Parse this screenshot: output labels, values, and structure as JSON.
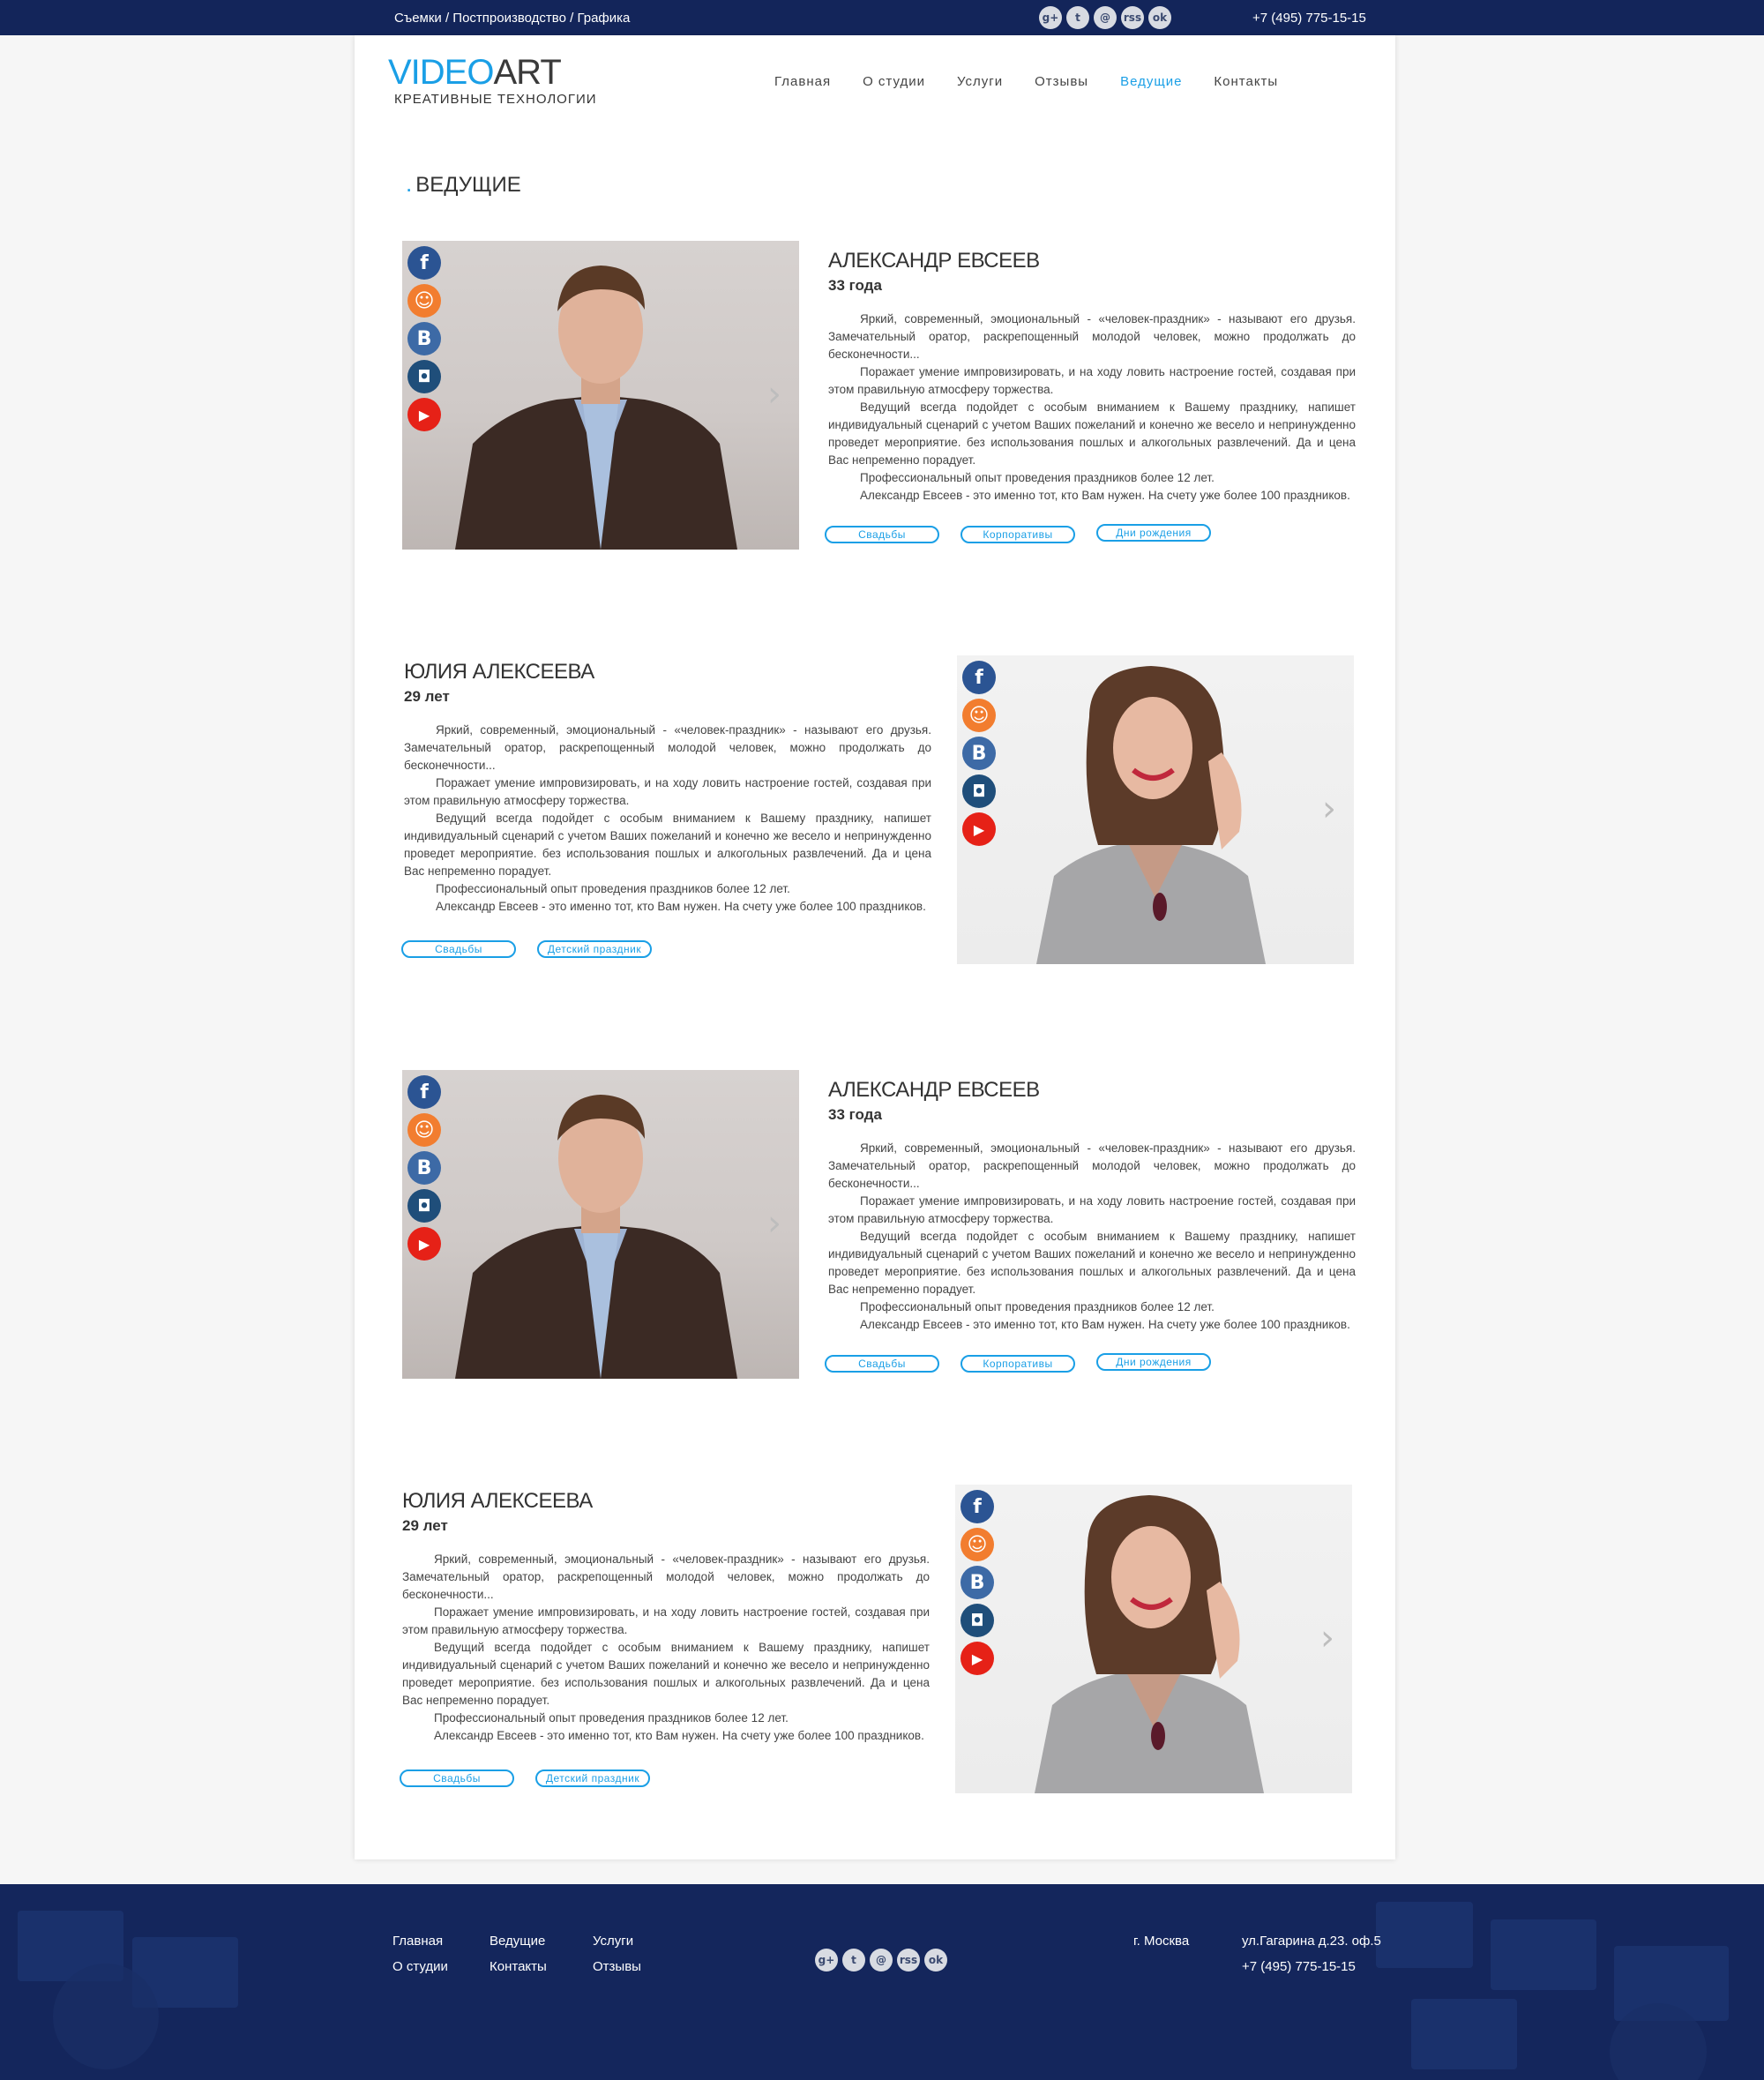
{
  "topbar": {
    "services": "Съемки / Постпроизводство / Графика",
    "phone": "+7 (495) 775-15-15",
    "social": [
      "g+",
      "t",
      "@",
      "rss",
      "ok"
    ]
  },
  "logo": {
    "video": "VIDEO",
    "art": "ART",
    "tagline": "КРЕАТИВНЫЕ ТЕХНОЛОГИИ"
  },
  "nav": [
    "Главная",
    "О студии",
    "Услуги",
    "Отзывы",
    "Ведущие",
    "Контакты"
  ],
  "page_title": "ВЕДУЩИЕ",
  "hosts": [
    {
      "name": "АЛЕКСАНДР ЕВСЕЕВ",
      "age": "33 года",
      "bio": [
        "Яркий, современный, эмоциональный - «человек-праздник» - называют его друзья. Замечательный оратор, раскрепощенный молодой человек, можно продолжать до бесконечности...",
        "Поражает умение импровизировать, и на ходу ловить настроение гостей, создавая при этом правильную атмосферу торжества.",
        "Ведущий всегда подойдет с особым вниманием к Вашему празднику, напишет индивидуальный сценарий с учетом Ваших пожеланий и конечно же весело и непринужденно проведет мероприятие. без использования пошлых и алкогольных развлечений. Да и цена Вас непременно порадует.",
        "Профессиональный опыт проведения праздников более 12 лет.",
        "Александр Евсеев - это именно тот, кто Вам нужен. На счету уже более 100 праздников."
      ],
      "tags": [
        "Свадьбы",
        "Корпоративы",
        "Дни рождения"
      ]
    },
    {
      "name": "ЮЛИЯ АЛЕКСЕЕВА",
      "age": "29 лет",
      "bio": [
        "Яркий, современный, эмоциональный - «человек-праздник» - называют его друзья. Замечательный оратор, раскрепощенный молодой человек, можно продолжать до бесконечности...",
        "Поражает умение импровизировать, и на ходу ловить настроение гостей, создавая при этом правильную атмосферу торжества.",
        "Ведущий всегда подойдет с особым вниманием к Вашему празднику, напишет индивидуальный сценарий с учетом Ваших пожеланий и конечно же весело и непринужденно проведет мероприятие. без использования пошлых и алкогольных развлечений. Да и цена Вас непременно порадует.",
        "Профессиональный опыт проведения праздников более 12 лет.",
        "Александр Евсеев - это именно тот, кто Вам нужен. На счету уже более 100 праздников."
      ],
      "tags": [
        "Свадьбы",
        "Детский праздник"
      ]
    },
    {
      "name": "АЛЕКСАНДР ЕВСЕЕВ",
      "age": "33 года",
      "bio": [
        "Яркий, современный, эмоциональный - «человек-праздник» - называют его друзья. Замечательный оратор, раскрепощенный молодой человек, можно продолжать до бесконечности...",
        "Поражает умение импровизировать, и на ходу ловить настроение гостей, создавая при этом правильную атмосферу торжества.",
        "Ведущий всегда подойдет с особым вниманием к Вашему празднику, напишет индивидуальный сценарий с учетом Ваших пожеланий и конечно же весело и непринужденно проведет мероприятие. без использования пошлых и алкогольных развлечений. Да и цена Вас непременно порадует.",
        "Профессиональный опыт проведения праздников более 12 лет.",
        "Александр Евсеев - это именно тот, кто Вам нужен. На счету уже более 100 праздников."
      ],
      "tags": [
        "Свадьбы",
        "Корпоративы",
        "Дни рождения"
      ]
    },
    {
      "name": "ЮЛИЯ АЛЕКСЕЕВА",
      "age": "29 лет",
      "bio": [
        "Яркий, современный, эмоциональный - «человек-праздник» - называют его друзья. Замечательный оратор, раскрепощенный молодой человек, можно продолжать до бесконечности...",
        "Поражает умение импровизировать, и на ходу ловить настроение гостей, создавая при этом правильную атмосферу торжества.",
        "Ведущий всегда подойдет с особым вниманием к Вашему празднику, напишет индивидуальный сценарий с учетом Ваших пожеланий и конечно же весело и непринужденно проведет мероприятие. без использования пошлых и алкогольных развлечений. Да и цена Вас непременно порадует.",
        "Профессиональный опыт проведения праздников более 12 лет.",
        "Александр Евсеев - это именно тот, кто Вам нужен. На счету уже более 100 праздников."
      ],
      "tags": [
        "Свадьбы",
        "Детский праздник"
      ]
    }
  ],
  "photo_social": [
    "f",
    "ok",
    "B",
    "ig",
    "yt"
  ],
  "footer": {
    "col1": [
      "Главная",
      "О студии"
    ],
    "col2": [
      "Ведущие",
      "Контакты"
    ],
    "col3": [
      "Услуги",
      "Отзывы"
    ],
    "city": "г. Москва",
    "address": "ул.Гагарина д.23. оф.5",
    "phone": "+7 (495) 775-15-15",
    "social": [
      "g+",
      "t",
      "@",
      "rss",
      "ok"
    ]
  },
  "colors": {
    "accent": "#1a9fe6",
    "navy": "#13255a"
  }
}
